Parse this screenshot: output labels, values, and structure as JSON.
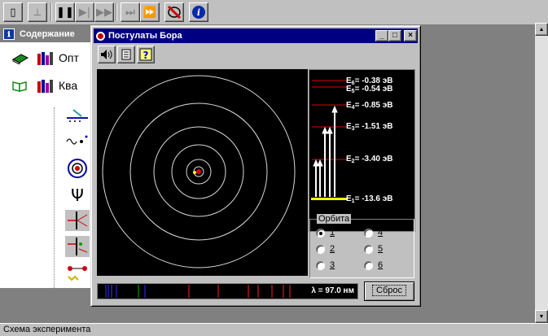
{
  "toolbar": {
    "buttons": [
      {
        "icon": "document-icon",
        "glyph": "▯",
        "enabled": true
      },
      {
        "icon": "pointer-icon",
        "glyph": "⟂",
        "enabled": false
      },
      {
        "icon": "pause-icon",
        "glyph": "❚❚",
        "enabled": true
      },
      {
        "icon": "step-forward-icon",
        "glyph": "▶|",
        "enabled": false
      },
      {
        "icon": "fast-forward-icon",
        "glyph": "▶▶",
        "enabled": false
      },
      {
        "icon": "skip-icon",
        "glyph": "⏭",
        "enabled": false
      },
      {
        "icon": "skip-end-icon",
        "glyph": "⏩",
        "enabled": false
      },
      {
        "icon": "sound-off-icon",
        "glyph": "🔇",
        "enabled": true
      },
      {
        "icon": "info-icon",
        "glyph": "i",
        "enabled": true
      }
    ]
  },
  "contents": {
    "title": "Содержание",
    "items": [
      {
        "label": "Опт"
      },
      {
        "label": "Ква"
      }
    ]
  },
  "bohr": {
    "title": "Постулаты Бора",
    "window_buttons": [
      "_",
      "□",
      "×"
    ],
    "levels": [
      {
        "n": "6",
        "energy": "= -0.38 эВ"
      },
      {
        "n": "5",
        "energy": "= -0.54 эВ"
      },
      {
        "n": "4",
        "energy": "= -0.85 эВ"
      },
      {
        "n": "3",
        "energy": "= -1.51 эВ"
      },
      {
        "n": "2",
        "energy": "= -3.40 эВ"
      },
      {
        "n": "1",
        "energy": "= -13.6 эВ"
      }
    ],
    "orbit_group_label": "Орбита",
    "orbit_options": [
      "1",
      "2",
      "3",
      "4",
      "5",
      "6"
    ],
    "selected_orbit": "1",
    "lambda_readout": "λ = 97.0 нм",
    "reset_label": "Сброс",
    "spectrum_colors": [
      "#3030ff",
      "#3030ff",
      "#4040ff",
      "#3030ff",
      "#00b000",
      "#3030ff",
      "#ff2020",
      "#ff2020",
      "#ff2020",
      "#ff2020",
      "#ff2020",
      "#ff2020",
      "#ff2020"
    ]
  },
  "status": {
    "text": "Схема эксперимента"
  }
}
